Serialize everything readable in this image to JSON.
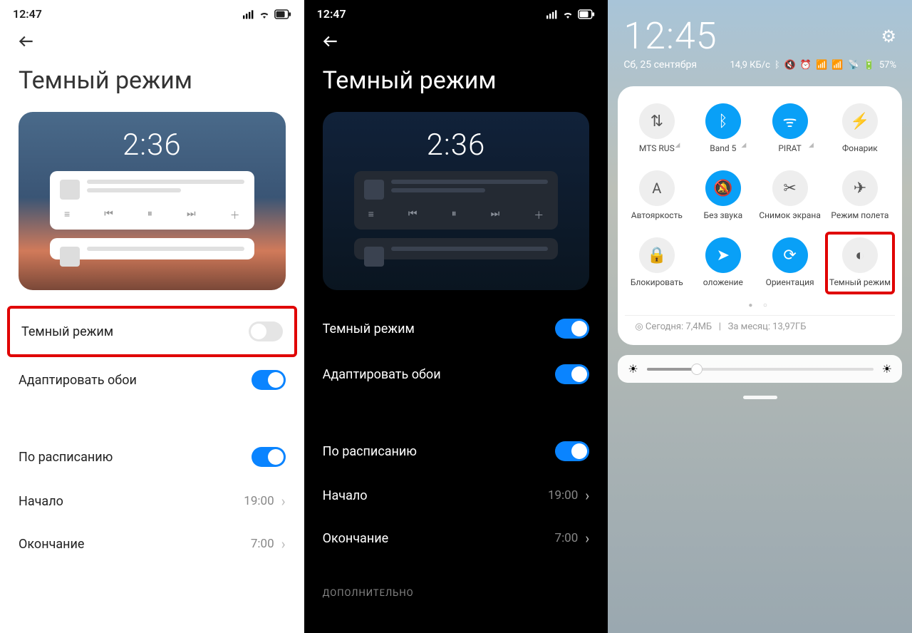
{
  "light": {
    "time": "12:47",
    "title": "Темный режим",
    "preview_time": "2:36",
    "rows": {
      "dark_mode": "Темный режим",
      "adapt_wallpaper": "Адаптировать обои",
      "schedule": "По расписанию",
      "start": "Начало",
      "start_val": "19:00",
      "end": "Окончание",
      "end_val": "7:00"
    },
    "toggles": {
      "dark_mode": false,
      "adapt_wallpaper": true,
      "schedule": true
    }
  },
  "dark": {
    "time": "12:47",
    "title": "Темный режим",
    "preview_time": "2:36",
    "rows": {
      "dark_mode": "Темный режим",
      "adapt_wallpaper": "Адаптировать обои",
      "schedule": "По расписанию",
      "start": "Начало",
      "start_val": "19:00",
      "end": "Окончание",
      "end_val": "7:00"
    },
    "section_extra": "ДОПОЛНИТЕЛЬНО",
    "toggles": {
      "dark_mode": true,
      "adapt_wallpaper": true,
      "schedule": true
    }
  },
  "panel": {
    "time": "12:45",
    "date": "Сб, 25 сентября",
    "speed": "14,9 КБ/с",
    "battery": "57%",
    "tiles": [
      {
        "label": "MTS RUS",
        "state": "off",
        "icon": "data",
        "sig": true
      },
      {
        "label": "Band 5",
        "state": "on",
        "icon": "bt",
        "sig": true
      },
      {
        "label": "PIRAT",
        "state": "on",
        "icon": "wifi",
        "sig": true
      },
      {
        "label": "Фонарик",
        "state": "off",
        "icon": "flash"
      },
      {
        "label": "Автояркость",
        "state": "off",
        "icon": "A"
      },
      {
        "label": "Без звука",
        "state": "on",
        "icon": "mute"
      },
      {
        "label": "Снимок экрана",
        "state": "off",
        "icon": "scr"
      },
      {
        "label": "Режим полета",
        "state": "off",
        "icon": "plane"
      },
      {
        "label": "Блокировать",
        "state": "off",
        "icon": "lock"
      },
      {
        "label": "оложение",
        "state": "on",
        "icon": "loc"
      },
      {
        "label": "Ориентация",
        "state": "on",
        "icon": "rot"
      },
      {
        "label": "Темный режим",
        "state": "off",
        "icon": "moon",
        "highlight": true
      }
    ],
    "usage_today_label": "Сегодня:",
    "usage_today": "7,4МБ",
    "usage_month_label": "За месяц:",
    "usage_month": "13,97ГБ"
  }
}
